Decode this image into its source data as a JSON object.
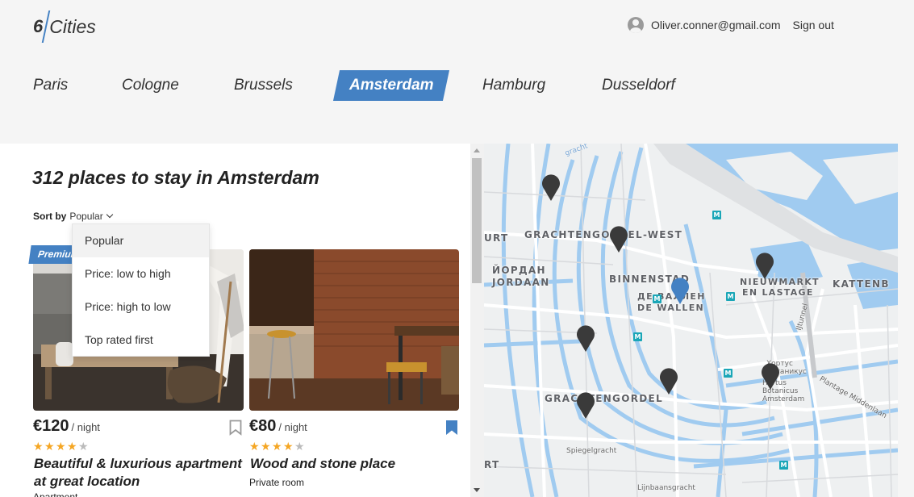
{
  "header": {
    "logo_number": "6",
    "logo_text": "Cities",
    "user_email": "Oliver.conner@gmail.com",
    "sign_out": "Sign out"
  },
  "tabs": [
    {
      "label": "Paris",
      "active": false
    },
    {
      "label": "Cologne",
      "active": false
    },
    {
      "label": "Brussels",
      "active": false
    },
    {
      "label": "Amsterdam",
      "active": true
    },
    {
      "label": "Hamburg",
      "active": false
    },
    {
      "label": "Dusseldorf",
      "active": false
    }
  ],
  "places": {
    "title": "312 places to stay in Amsterdam",
    "sort_label": "Sort by",
    "sort_value": "Popular",
    "sort_options": [
      "Popular",
      "Price: low to high",
      "Price: high to low",
      "Top rated first"
    ]
  },
  "offers": [
    {
      "premium": "Premium",
      "price": "€120",
      "per": "/ night",
      "rating": 4,
      "name": "Beautiful & luxurious apartment at great location",
      "type": "Apartment",
      "bookmarked": false
    },
    {
      "price": "€80",
      "per": "/ night",
      "rating": 4,
      "name": "Wood and stone place",
      "type": "Private room",
      "bookmarked": true
    }
  ],
  "map": {
    "labels": [
      "GRACHTENGORDEL-WEST",
      "JORDAAN",
      "ЙОРДАН",
      "BINNENSTAD",
      "DE WALLEN",
      "ДЕ ВАЛЛЕН",
      "NIEUWMARKT",
      "EN LASTAGE",
      "KATTENB",
      "GRACHTENGORDEL",
      "URT",
      "RT"
    ],
    "small_labels": [
      "IJtunnel",
      "Plantage Middenlaan",
      "Hortus Botanicus Amsterdam",
      "Хортус Ботаникус",
      "Spiegelgracht",
      "Lijnbaansgracht"
    ],
    "metro_symbol": "M",
    "accent_color": "#4481c3",
    "water_color": "#a0cbf0"
  }
}
